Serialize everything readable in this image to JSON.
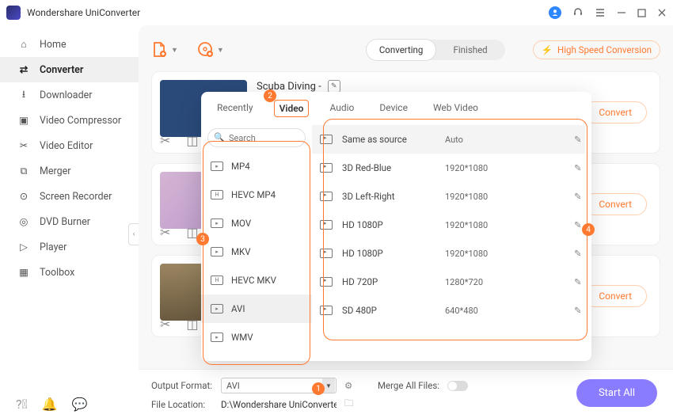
{
  "app": {
    "name": "Wondershare UniConverter"
  },
  "sidebar": {
    "items": [
      {
        "label": "Home"
      },
      {
        "label": "Converter"
      },
      {
        "label": "Downloader"
      },
      {
        "label": "Video Compressor"
      },
      {
        "label": "Video Editor"
      },
      {
        "label": "Merger"
      },
      {
        "label": "Screen Recorder"
      },
      {
        "label": "DVD Burner"
      },
      {
        "label": "Player"
      },
      {
        "label": "Toolbox"
      }
    ]
  },
  "toolbar": {
    "segment": {
      "converting": "Converting",
      "finished": "Finished"
    },
    "hsc": "High Speed Conversion"
  },
  "file": {
    "title": "Scuba Diving -"
  },
  "cards": {
    "convert_label": "Convert"
  },
  "dropdown": {
    "tabs": {
      "recently": "Recently",
      "video": "Video",
      "audio": "Audio",
      "device": "Device",
      "webvideo": "Web Video"
    },
    "search_placeholder": "Search",
    "formats": [
      "MP4",
      "HEVC MP4",
      "MOV",
      "MKV",
      "HEVC MKV",
      "AVI",
      "WMV"
    ],
    "resolutions": [
      {
        "label": "Same as source",
        "res": "Auto"
      },
      {
        "label": "3D Red-Blue",
        "res": "1920*1080"
      },
      {
        "label": "3D Left-Right",
        "res": "1920*1080"
      },
      {
        "label": "HD 1080P",
        "res": "1920*1080"
      },
      {
        "label": "HD 1080P",
        "res": "1920*1080"
      },
      {
        "label": "HD 720P",
        "res": "1280*720"
      },
      {
        "label": "SD 480P",
        "res": "640*480"
      }
    ]
  },
  "bottom": {
    "output_format_label": "Output Format:",
    "output_format_value": "AVI",
    "file_location_label": "File Location:",
    "file_location_value": "D:\\Wondershare UniConverter",
    "merge_label": "Merge All Files:",
    "startall": "Start All"
  },
  "badges": {
    "b1": "1",
    "b2": "2",
    "b3": "3",
    "b4": "4"
  }
}
